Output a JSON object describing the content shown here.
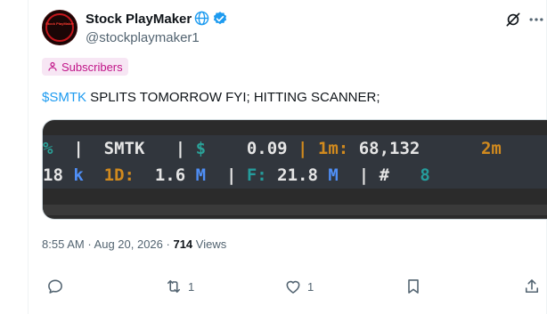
{
  "tweet": {
    "author_name": "Stock PlayMaker",
    "author_handle": "@stockplaymaker1",
    "avatar_text": "Stock PlayMaker",
    "badge_label": "Subscribers",
    "cashtag": "$SMTK",
    "text_rest": " SPLITS TOMORROW FYI; HITTING SCANNER;",
    "time": "8:55 AM",
    "date": "Aug 20, 2026",
    "views_count": "714",
    "views_label": "Views"
  },
  "terminal": {
    "row1": {
      "pct": "%",
      "sep1": "  |  ",
      "symbol": "SMTK",
      "sep2": "   | ",
      "dollar": "$",
      "price": "    0.09 ",
      "sep3": "| ",
      "vol1m_label": "1m:",
      "vol1m_value": " 68,132",
      "next_label": "      2m"
    },
    "row2": {
      "vol_tail": "18",
      "k_unit": " k  ",
      "d1_label": "1D:",
      "d1_value": "  1.6",
      "m_unit1": " M  ",
      "sep": "|",
      "f_label": " F:",
      "f_value": " 21.8",
      "m_unit2": " M ",
      "sep2": " | ",
      "hash": "# ",
      "count": "  8"
    }
  },
  "actions": {
    "reply_count": "",
    "retweet_count": "1",
    "like_count": "1"
  },
  "colors": {
    "accent": "#1d9bf0",
    "badge_text": "#c11488",
    "badge_bg": "#f7e6f4"
  }
}
